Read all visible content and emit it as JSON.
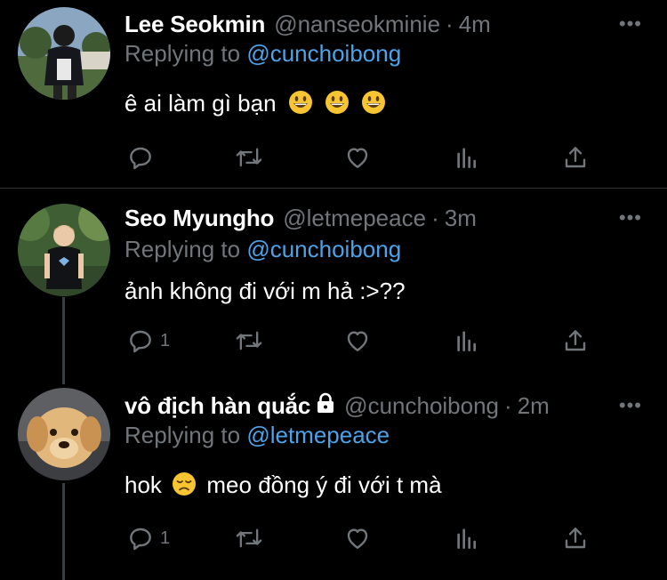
{
  "tweets": [
    {
      "name": "Lee Seokmin",
      "handle": "@nanseokminie",
      "dot": "·",
      "time": "4m",
      "replying_prefix": "Replying to",
      "replying_to": "@cunchoibong",
      "text": "ê ai làm gì bạn",
      "emojis": [
        "grinning-face",
        "grinning-face",
        "grinning-face"
      ],
      "reply_count": "",
      "more": "•••"
    },
    {
      "name": "Seo Myungho",
      "handle": "@letmepeace",
      "dot": "·",
      "time": "3m",
      "replying_prefix": "Replying to",
      "replying_to": "@cunchoibong",
      "text": "ảnh không đi với m hả :>??",
      "reply_count": "1",
      "more": "•••"
    },
    {
      "name": "vô địch hàn quắc",
      "handle": "@cunchoibong",
      "dot": "·",
      "time": "2m",
      "replying_prefix": "Replying to",
      "replying_to": "@letmepeace",
      "text_before": "hok",
      "emoji": "disappointed-face",
      "text_after": "meo đồng ý đi với t mà",
      "reply_count": "1",
      "protected_icon": "lock-icon",
      "more": "•••"
    }
  ],
  "colors": {
    "background": "#000000",
    "text": "#ffffff",
    "secondary": "#71767b",
    "link": "#4da3e8",
    "divider": "#2f3336"
  }
}
